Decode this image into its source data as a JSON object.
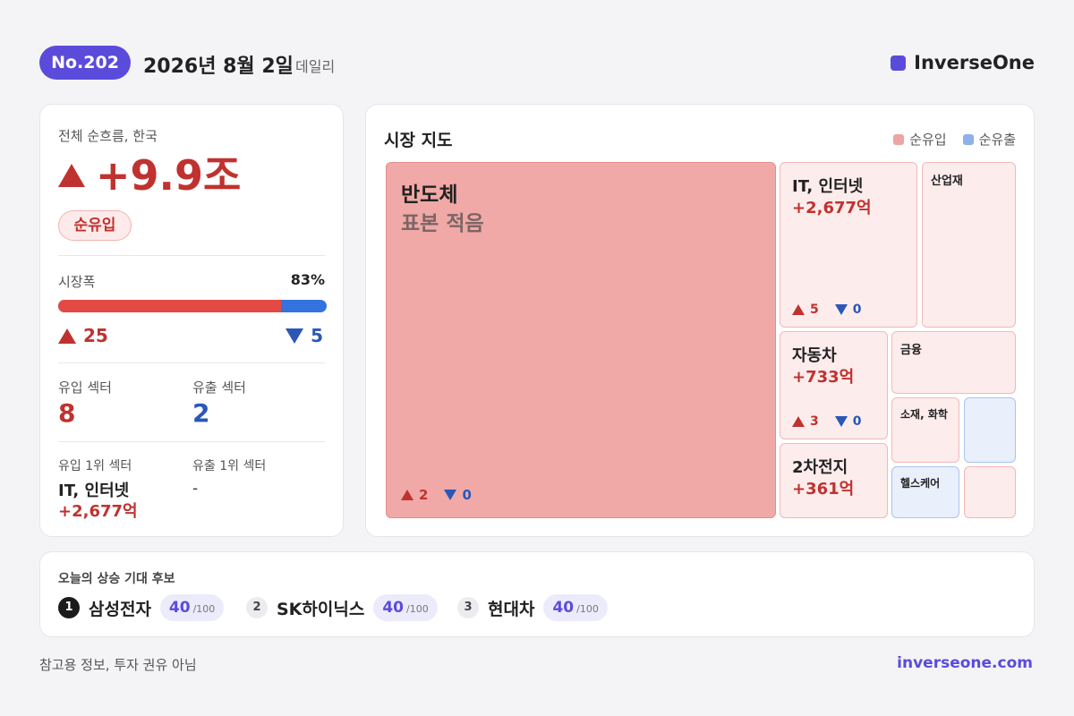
{
  "header": {
    "badge": "No.202",
    "date": "2026년 8월 2일",
    "edition": "데일리",
    "brand": "InverseOne"
  },
  "summary": {
    "label": "전체 순흐름, 한국",
    "value": "+9.9조",
    "direction": "up",
    "status": "순유입",
    "breadth_label": "시장폭",
    "breadth_pct": "83%",
    "breadth_fraction": 0.83,
    "advancers": "25",
    "decliners": "5",
    "inflow_sectors_label": "유입 섹터",
    "inflow_sectors": "8",
    "outflow_sectors_label": "유출 섹터",
    "outflow_sectors": "2",
    "top_inflow_label": "유입 1위 섹터",
    "top_inflow_name": "IT, 인터넷",
    "top_inflow_value": "+2,677억",
    "top_outflow_label": "유출 1위 섹터",
    "top_outflow_name": "-"
  },
  "market_map": {
    "title": "시장 지도",
    "legend_in": "순유입",
    "legend_out": "순유출",
    "tiles": {
      "semis": {
        "name": "반도체",
        "note": "표본 적음",
        "up": "2",
        "down": "0"
      },
      "it": {
        "name": "IT, 인터넷",
        "value": "+2,677억",
        "up": "5",
        "down": "0"
      },
      "industrial": {
        "name": "산업재"
      },
      "auto": {
        "name": "자동차",
        "value": "+733억",
        "up": "3",
        "down": "0"
      },
      "finance": {
        "name": "금융"
      },
      "battery": {
        "name": "2차전지",
        "value": "+361억"
      },
      "materials": {
        "name": "소재, 화학"
      },
      "healthcare": {
        "name": "헬스케어"
      }
    }
  },
  "candidates": {
    "title": "오늘의 상승 기대 후보",
    "score_max": "/100",
    "items": [
      {
        "rank": "1",
        "name": "삼성전자",
        "score": "40"
      },
      {
        "rank": "2",
        "name": "SK하이닉스",
        "score": "40"
      },
      {
        "rank": "3",
        "name": "현대차",
        "score": "40"
      }
    ]
  },
  "footer": {
    "disclaimer": "참고용 정보, 투자 권유 아님",
    "site": "inverseone.com"
  },
  "colors": {
    "accent": "#5b4bdb",
    "inflow": "#c0322f",
    "outflow": "#2a57b8",
    "inflow_bar": "#e24a43",
    "outflow_bar": "#3472e0"
  }
}
